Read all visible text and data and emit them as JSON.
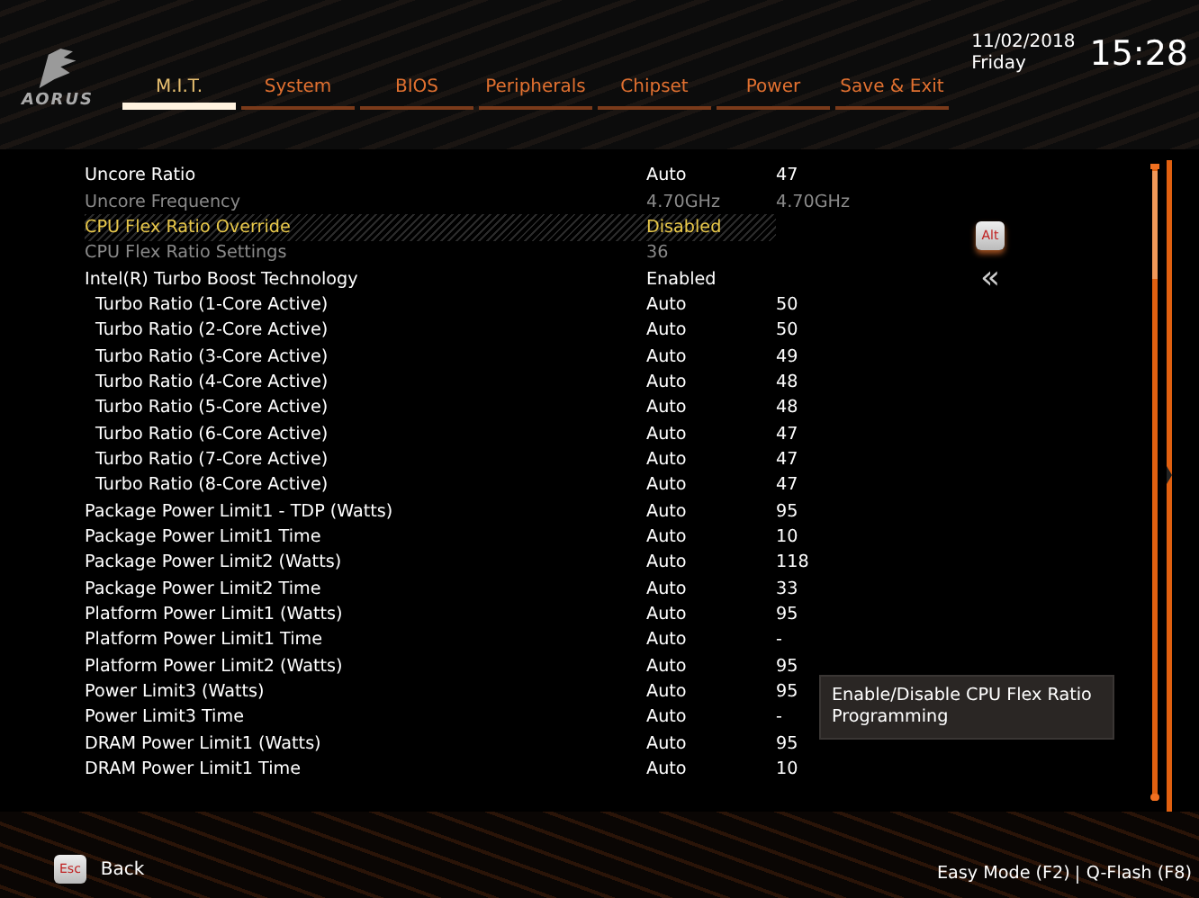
{
  "brand": {
    "text": "AORUS"
  },
  "tabs": [
    {
      "label": "M.I.T.",
      "selected": true
    },
    {
      "label": "System",
      "selected": false
    },
    {
      "label": "BIOS",
      "selected": false
    },
    {
      "label": "Peripherals",
      "selected": false
    },
    {
      "label": "Chipset",
      "selected": false
    },
    {
      "label": "Power",
      "selected": false
    },
    {
      "label": "Save & Exit",
      "selected": false
    }
  ],
  "clock": {
    "date": "11/02/2018",
    "weekday": "Friday",
    "time": "15:28"
  },
  "settings": [
    {
      "label": "Uncore Ratio",
      "value": "Auto",
      "current": "47",
      "selected": false,
      "disabled": false
    },
    {
      "label": "Uncore Frequency",
      "value": "4.70GHz",
      "current": "4.70GHz",
      "selected": false,
      "disabled": true
    },
    {
      "label": "CPU Flex Ratio Override",
      "value": "Disabled",
      "selected": true,
      "disabled": false
    },
    {
      "label": "CPU Flex Ratio Settings",
      "value": "36",
      "selected": false,
      "disabled": true
    },
    {
      "label": "Intel(R) Turbo Boost Technology",
      "value": "Enabled",
      "selected": false,
      "disabled": false,
      "children": [
        {
          "label": "Turbo Ratio (1-Core Active)",
          "value": "Auto",
          "current": "50",
          "selected": false,
          "disabled": false
        },
        {
          "label": "Turbo Ratio (2-Core Active)",
          "value": "Auto",
          "current": "50",
          "selected": false,
          "disabled": false
        },
        {
          "label": "Turbo Ratio (3-Core Active)",
          "value": "Auto",
          "current": "49",
          "selected": false,
          "disabled": false
        },
        {
          "label": "Turbo Ratio (4-Core Active)",
          "value": "Auto",
          "current": "48",
          "selected": false,
          "disabled": false
        },
        {
          "label": "Turbo Ratio (5-Core Active)",
          "value": "Auto",
          "current": "48",
          "selected": false,
          "disabled": false
        },
        {
          "label": "Turbo Ratio (6-Core Active)",
          "value": "Auto",
          "current": "47",
          "selected": false,
          "disabled": false
        },
        {
          "label": "Turbo Ratio (7-Core Active)",
          "value": "Auto",
          "current": "47",
          "selected": false,
          "disabled": false
        },
        {
          "label": "Turbo Ratio (8-Core Active)",
          "value": "Auto",
          "current": "47",
          "selected": false,
          "disabled": false
        }
      ]
    },
    {
      "label": "Package Power Limit1 - TDP (Watts)",
      "value": "Auto",
      "current": "95",
      "selected": false,
      "disabled": false
    },
    {
      "label": "Package Power Limit1 Time",
      "value": "Auto",
      "current": "10",
      "selected": false,
      "disabled": false
    },
    {
      "label": "Package Power Limit2 (Watts)",
      "value": "Auto",
      "current": "118",
      "selected": false,
      "disabled": false
    },
    {
      "label": "Package Power Limit2 Time",
      "value": "Auto",
      "current": "33",
      "selected": false,
      "disabled": false
    },
    {
      "label": "Platform Power Limit1 (Watts)",
      "value": "Auto",
      "current": "95",
      "selected": false,
      "disabled": false
    },
    {
      "label": "Platform Power Limit1 Time",
      "value": "Auto",
      "current": "-",
      "selected": false,
      "disabled": false
    },
    {
      "label": "Platform Power Limit2 (Watts)",
      "value": "Auto",
      "current": "95",
      "selected": false,
      "disabled": false
    },
    {
      "label": "Power Limit3 (Watts)",
      "value": "Auto",
      "current": "95",
      "selected": false,
      "disabled": false
    },
    {
      "label": "Power Limit3 Time",
      "value": "Auto",
      "current": "-",
      "selected": false,
      "disabled": false
    },
    {
      "label": "DRAM Power Limit1 (Watts)",
      "value": "Auto",
      "current": "95",
      "selected": false,
      "disabled": false
    },
    {
      "label": "DRAM Power Limit1 Time",
      "value": "Auto",
      "current": "10",
      "selected": false,
      "disabled": false
    }
  ],
  "side_keys": [
    {
      "key": "Alt"
    },
    {
      "symbol": "«"
    }
  ],
  "help": "Enable/Disable CPU Flex Ratio Programming",
  "footer": {
    "back_key": "Esc",
    "back_label": "Back",
    "actions": [
      "Easy Mode (F2)",
      "Q-Flash (F8)"
    ]
  }
}
